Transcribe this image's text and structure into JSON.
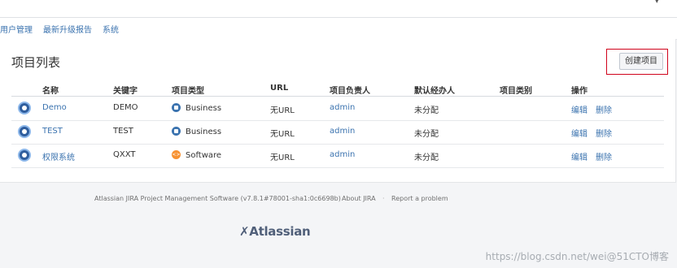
{
  "subnav": {
    "items": [
      {
        "label": "用户管理"
      },
      {
        "label": "最新升级报告"
      },
      {
        "label": "系统"
      }
    ]
  },
  "page": {
    "title": "项目列表",
    "create_button": "创建项目"
  },
  "table": {
    "headers": {
      "name": "名称",
      "key": "关键字",
      "type": "项目类型",
      "url": "URL",
      "lead": "项目负责人",
      "assignee": "默认经办人",
      "category": "项目类别",
      "actions": "操作"
    },
    "rows": [
      {
        "name": "Demo",
        "key": "DEMO",
        "type": "Business",
        "type_icon": "business-icon",
        "url": "无URL",
        "lead": "admin",
        "assignee": "未分配",
        "category": "",
        "edit": "编辑",
        "delete": "删除"
      },
      {
        "name": "TEST",
        "key": "TEST",
        "type": "Business",
        "type_icon": "business-icon",
        "url": "无URL",
        "lead": "admin",
        "assignee": "未分配",
        "category": "",
        "edit": "编辑",
        "delete": "删除"
      },
      {
        "name": "权限系统",
        "key": "QXXT",
        "type": "Software",
        "type_icon": "software-icon",
        "url": "无URL",
        "lead": "admin",
        "assignee": "未分配",
        "category": "",
        "edit": "编辑",
        "delete": "删除"
      }
    ]
  },
  "footer": {
    "version": "Atlassian JIRA Project Management Software (v7.8.1#78001-sha1:0c6698b)",
    "about": "About JIRA",
    "report": "Report a problem",
    "separator": "·",
    "logo": "Atlassian"
  },
  "watermark": "https://blog.csdn.net/wei@51CTO博客",
  "colors": {
    "link": "#3b73af",
    "highlight_border": "#d0021b",
    "business_icon": "#3b73af",
    "software_icon": "#f79232"
  }
}
